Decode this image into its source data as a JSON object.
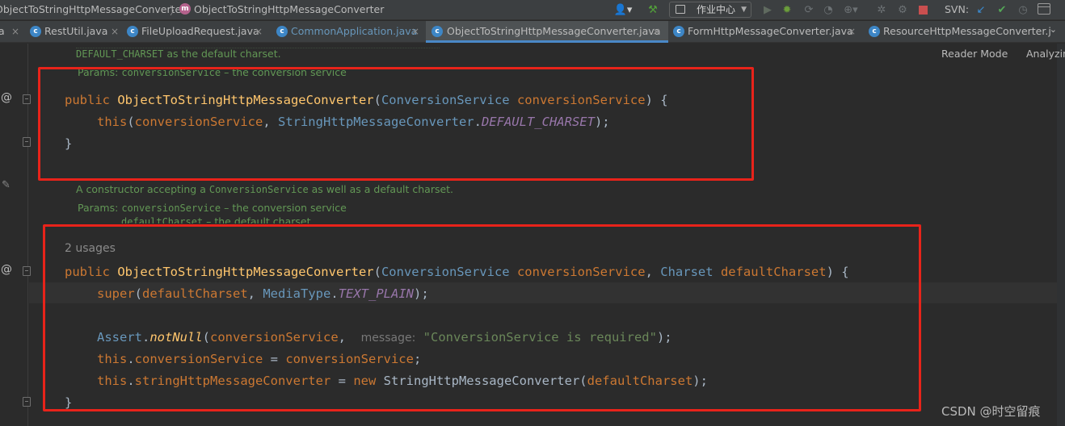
{
  "navbar": {
    "breadcrumb_class": "ObjectToStringHttpMessageConverter",
    "breadcrumb_method": "ObjectToStringHttpMessageConverter",
    "method_badge": "m",
    "work_center_label": "作业中心",
    "svn_label": "SVN:"
  },
  "tabs": [
    {
      "label": "a",
      "close": "×"
    },
    {
      "label": "RestUtil.java",
      "close": "×",
      "icon": "c"
    },
    {
      "label": "FileUploadRequest.java",
      "close": "×",
      "icon": "c"
    },
    {
      "label": "CommonApplication.java",
      "close": "×",
      "icon": "c",
      "modified": true
    },
    {
      "label": "ObjectToStringHttpMessageConverter.java",
      "close": "×",
      "icon": "c",
      "active": true
    },
    {
      "label": "FormHttpMessageConverter.java",
      "close": "×",
      "icon": "c"
    },
    {
      "label": "ResourceHttpMessageConverter.j",
      "close": "",
      "icon": "c"
    }
  ],
  "editor": {
    "reader_mode": "Reader Mode",
    "analyzing": "Analyzing",
    "doc1": {
      "line1_code": "DEFAULT_CHARSET",
      "line1_text": " as the default charset.",
      "params_label": "Params: ",
      "params_code": "conversionService",
      "params_text": " – the conversion service"
    },
    "ctor1": {
      "kw_public": "public",
      "name": "ObjectToStringHttpMessageConverter",
      "open": "(",
      "param_type": "ConversionService",
      "param_name": "conversionService",
      "close_brace": ") {",
      "this_kw": "this",
      "this_open": "(",
      "arg1": "conversionService",
      "comma": ", ",
      "arg_class": "StringHttpMessageConverter",
      "dot": ".",
      "arg_const": "DEFAULT_CHARSET",
      "end": ");",
      "brace": "}"
    },
    "doc2": {
      "line1_a": "A constructor accepting a ",
      "line1_code": "ConversionService",
      "line1_b": " as well as a default charset.",
      "params_label": "Params: ",
      "param1_code": "conversionService",
      "param1_text": " – the conversion service",
      "param2_code": "defaultCharset",
      "param2_text": " – the default charset"
    },
    "usages": "2 usages",
    "ctor2": {
      "kw_public": "public",
      "name": "ObjectToStringHttpMessageConverter",
      "open": "(",
      "p1_type": "ConversionService",
      "p1_name": "conversionService",
      "comma": ", ",
      "p2_type": "Charset",
      "p2_name": "defaultCharset",
      "close_brace": ") {",
      "super_kw": "super",
      "super_open": "(",
      "super_arg1": "defaultCharset",
      "super_class": "MediaType",
      "dot": ".",
      "super_const": "TEXT_PLAIN",
      "end": ");",
      "assert_class": "Assert",
      "assert_method": "notNull",
      "assert_arg": "conversionService",
      "assert_comma": ",",
      "hint_label": "message:",
      "assert_string": "\"ConversionService is required\"",
      "this_kw": "this",
      "field1": "conversionService",
      "eq": " = ",
      "rhs1": "conversionService",
      "semi": ";",
      "field2": "stringHttpMessageConverter",
      "new_kw": "new",
      "new_class": "StringHttpMessageConverter",
      "new_arg": "defaultCharset",
      "brace": "}"
    }
  },
  "watermark": "CSDN @时空留痕",
  "colors": {
    "keyword": "#cc7832",
    "method": "#ffc66d",
    "field": "#9876aa",
    "string": "#6a8759",
    "doc": "#629755",
    "highlight_box": "#e8231a"
  }
}
